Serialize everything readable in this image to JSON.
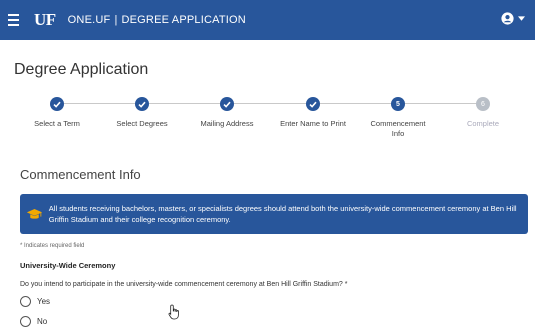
{
  "header": {
    "logo": "UF",
    "app_name": "ONE.UF",
    "separator": "|",
    "section": "DEGREE APPLICATION",
    "icons": {
      "menu": "hamburger-icon",
      "user": "user-icon",
      "caret": "chevron-down-icon"
    }
  },
  "page": {
    "title": "Degree Application"
  },
  "stepper": {
    "steps": [
      {
        "label": "Select a Term",
        "state": "done",
        "marker": ""
      },
      {
        "label": "Select Degrees",
        "state": "done",
        "marker": ""
      },
      {
        "label": "Mailing Address",
        "state": "done",
        "marker": ""
      },
      {
        "label": "Enter Name to Print",
        "state": "done",
        "marker": ""
      },
      {
        "label": "Commencement Info",
        "state": "current",
        "marker": "5"
      },
      {
        "label": "Complete",
        "state": "todo",
        "marker": "6"
      }
    ]
  },
  "commencement": {
    "title": "Commencement Info",
    "alert": "All students receiving bachelors, masters, or specialists degrees should attend both the university-wide commencement ceremony at Ben Hill Griffin Stadium and their college recognition ceremony.",
    "alert_icon": "graduation-cap-icon",
    "required_note": "* Indicates required field",
    "subheading": "University-Wide Ceremony",
    "question": "Do you intend to participate in the university-wide commencement ceremony at Ben Hill Griffin Stadium? *",
    "options": [
      "Yes",
      "No"
    ]
  },
  "colors": {
    "brand_blue": "#28569b",
    "inactive_step": "#b9bfc7"
  }
}
